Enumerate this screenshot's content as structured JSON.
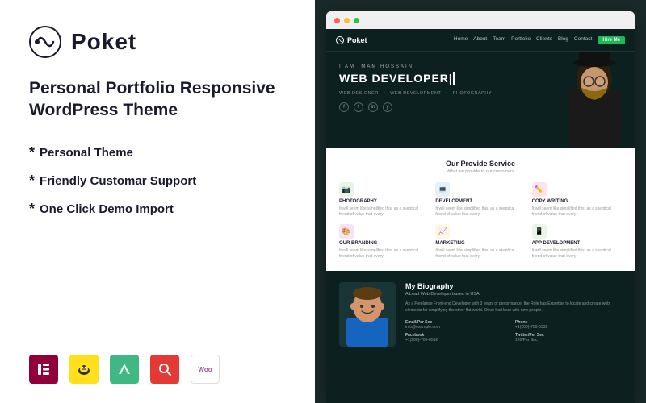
{
  "left": {
    "logo_text": "Poket",
    "tagline": "Personal Portfolio Responsive\nWordPress Theme",
    "features": [
      "Personal Theme",
      "Friendly Customar Support",
      "One Click Demo Import"
    ],
    "badges": [
      {
        "name": "elementor",
        "label": "E",
        "bg": "#92003b",
        "color": "#fff"
      },
      {
        "name": "mailchimp",
        "label": "✉",
        "bg": "#ffe01b",
        "color": "#333"
      },
      {
        "name": "vuejs",
        "label": "▽",
        "bg": "#41b883",
        "color": "#fff"
      },
      {
        "name": "qr",
        "label": "◎",
        "bg": "#e53935",
        "color": "#fff"
      },
      {
        "name": "woocommerce",
        "label": "Woo",
        "bg": "#fff",
        "color": "#96588a"
      }
    ]
  },
  "site": {
    "nav": {
      "logo": "Poket",
      "links": [
        "Home",
        "About",
        "Team",
        "Portfolio",
        "Clients",
        "Blog",
        "Contact"
      ],
      "cta": "Hire Me"
    },
    "hero": {
      "pre_title": "I AM IMAM HOSSAIN",
      "title": "WEB DEVELOPER",
      "tags": [
        "WEB DESIGNER",
        "WEB DEVELOPMENT",
        "PHOTOGRAPHY"
      ]
    },
    "services": {
      "title": "Our Provide Service",
      "subtitle": "What we provide to our customers",
      "items": [
        {
          "icon": "📷",
          "name": "PHOTOGRAPHY",
          "desc": "It will seem like simplified this, as a skeptical friend of value that every"
        },
        {
          "icon": "💻",
          "name": "DEVELOPMENT",
          "desc": "It will seem like simplified this, as a skeptical friend of value that every"
        },
        {
          "icon": "✏️",
          "name": "COPY WRITING",
          "desc": "It will seem like simplified this, as a skeptical friend of value that every"
        },
        {
          "icon": "🎨",
          "name": "OUR BRANDING",
          "desc": "It will seem like simplified this, as a skeptical friend of value that every"
        },
        {
          "icon": "📈",
          "name": "MARKETING",
          "desc": "It will seem like simplified this, as a skeptical friend of value that every"
        },
        {
          "icon": "📱",
          "name": "APP DEVELOPMENT",
          "desc": "It will seem like simplified this, as a skeptical friend of value that every"
        }
      ]
    },
    "bio": {
      "title": "My Biography",
      "role": "A Lead Web Developer based in USA",
      "desc": "As a Freelance Front-end Developer with 3 years of pertormance, the Role has Expertise to locate and create web elements for simplifying the other flat world. Other had born with new people.",
      "details": [
        {
          "label": "Email/Per Sec",
          "value": "info@example.com"
        },
        {
          "label": "Facebook",
          "value": "+1(200)-700-6532"
        },
        {
          "label": "Twitter/Per Sec",
          "value": "120/Per Sec"
        },
        {
          "label": "Phone",
          "value": "+1(200)-700-6532"
        }
      ]
    }
  }
}
